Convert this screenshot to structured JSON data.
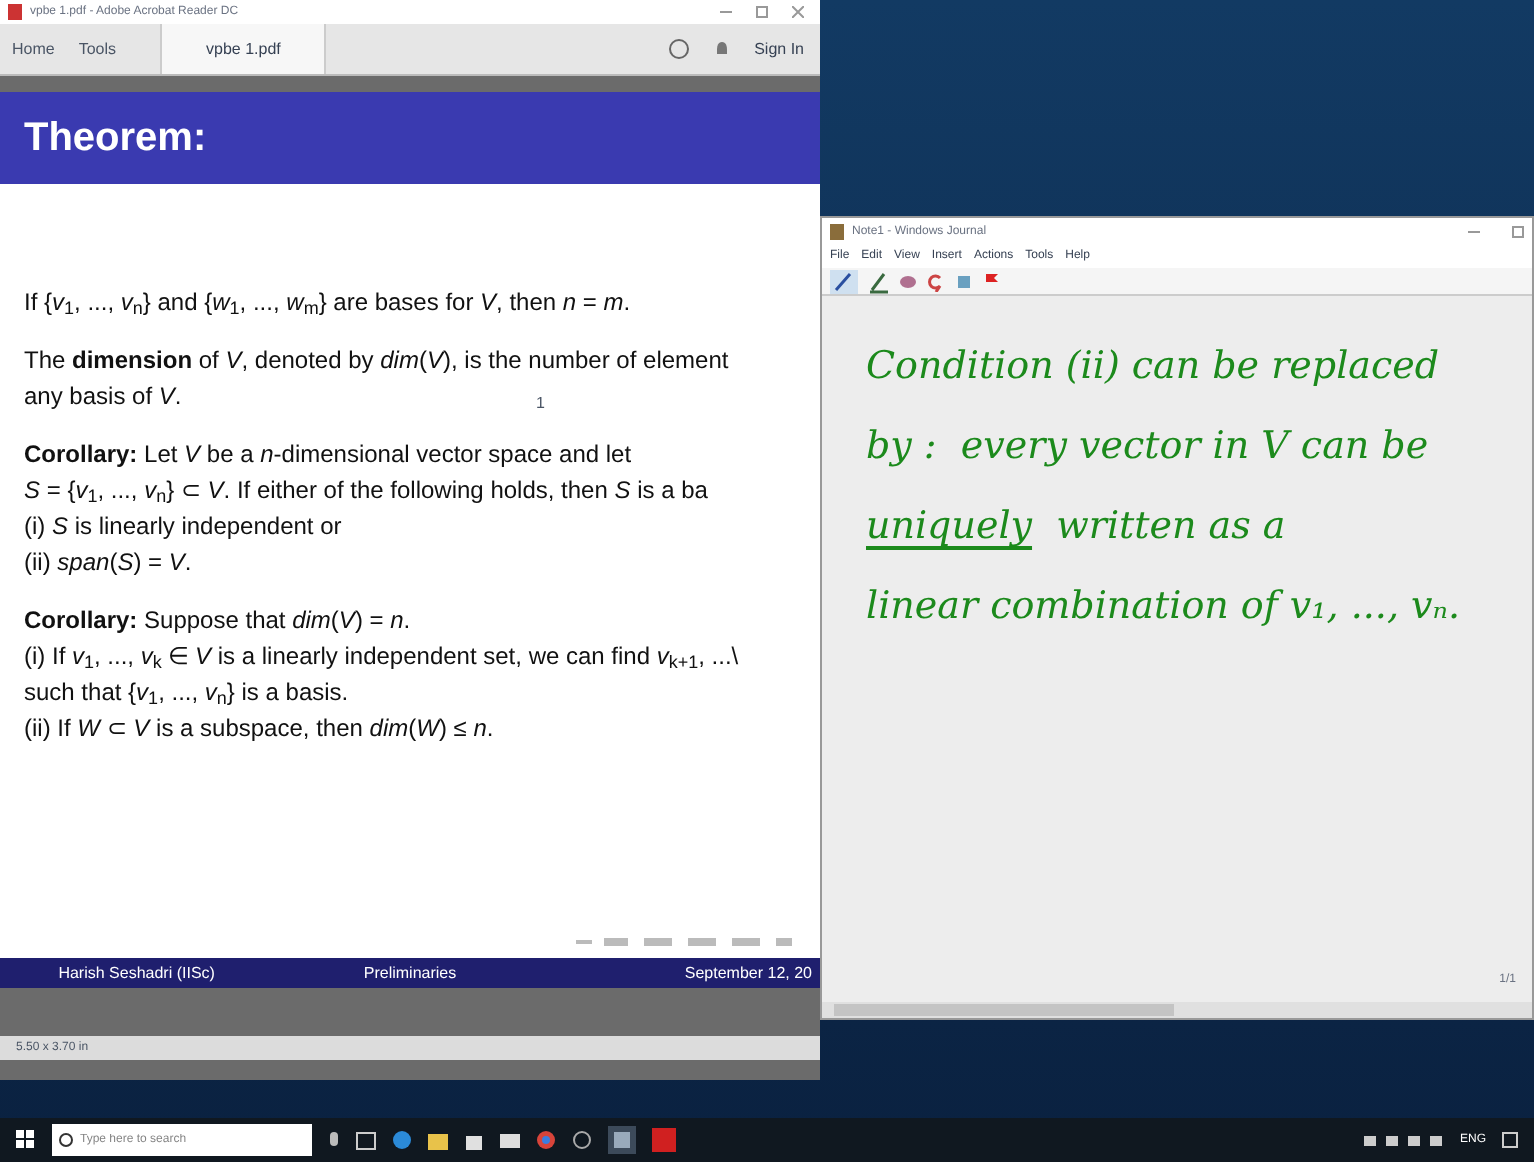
{
  "acrobat": {
    "title": "vpbe 1.pdf - Adobe Acrobat Reader DC",
    "nav": [
      {
        "label": "Home",
        "selected": false
      },
      {
        "label": "Tools",
        "selected": false
      },
      {
        "label": "vpbe 1.pdf",
        "selected": true
      }
    ],
    "sign_in": "Sign In",
    "slide": {
      "header": "Theorem:",
      "marker": "1",
      "blocks": [
        [
          "If {*v*$_{1}$, ..., *v*$_{n}$} and {*w*$_{1}$, ..., *w*$_{m}$} are bases for *V*, then *n* = *m*."
        ],
        [
          "The **dimension** of *V*, denoted by *dim*(*V*), is the number of element",
          "any basis of *V*."
        ],
        [
          "**Corollary:** Let *V* be a *n*-dimensional vector space and let",
          "*S* = {*v*$_{1}$, ..., *v*$_{n}$} ⊂ *V*. If either of the following holds, then *S* is a ba",
          "(i) *S* is linearly independent or",
          "(ii) *span*(*S*) = *V*."
        ],
        [
          "**Corollary:** Suppose that *dim*(*V*) = *n*.",
          "(i) If *v*$_{1}$, ..., *v*$_{k}$ ∈ *V* is a linearly independent set, we can find *v*$_{k+1}$, ...\\",
          "such that {*v*$_{1}$, ..., *v*$_{n}$} is a basis.",
          "(ii) If *W* ⊂ *V* is a subspace, then *dim*(*W*) ≤ *n*."
        ]
      ],
      "footer": [
        "Harish Seshadri (IISc)",
        "Preliminaries",
        "September 12, 20"
      ]
    },
    "status": "5.50 x 3.70 in"
  },
  "journal": {
    "title": "Note1 - Windows Journal",
    "menu": [
      "File",
      "Edit",
      "View",
      "Insert",
      "Actions",
      "Tools",
      "Help"
    ],
    "handwriting": [
      [
        {
          "text": "Condition (ii) can be replaced",
          "underlined": false
        }
      ],
      [
        {
          "text": "by :  every vector in V can be",
          "underlined": false
        }
      ],
      [
        {
          "text": "uniquely",
          "underlined": true
        },
        {
          "text": "  written as a",
          "underlined": false
        }
      ],
      [
        {
          "text": "linear combination of v₁, ..., vₙ.",
          "underlined": false
        }
      ]
    ],
    "page": "1/1"
  },
  "taskbar": {
    "search_placeholder": "Type here to search",
    "language": "ENG"
  }
}
